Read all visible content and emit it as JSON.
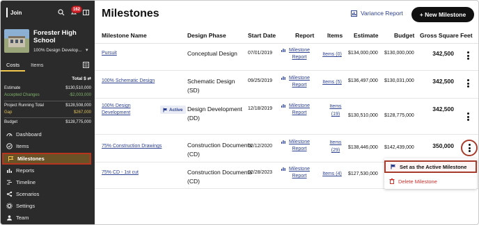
{
  "sidebar": {
    "logo": "Join",
    "notifications": "162",
    "project": {
      "name": "Forester High School",
      "phase": "100% Design Develop..."
    },
    "tabs": [
      "Costs",
      "Items"
    ],
    "total_label": "Total $",
    "costs": [
      {
        "label": "Estimate",
        "value": "$130,510,000",
        "tone": "white"
      },
      {
        "label": "Accepted Changes",
        "value": "-$2,003,000",
        "tone": "green"
      },
      {
        "label": "Project Running Total",
        "value": "$128,508,000",
        "tone": "white"
      },
      {
        "label": "Gap",
        "value": "$267,000",
        "tone": "yellow"
      },
      {
        "label": "Budget",
        "value": "$128,775,000",
        "tone": "white"
      }
    ],
    "nav": [
      "Dashboard",
      "Items",
      "Milestones",
      "Reports",
      "Timeline",
      "Scenarios",
      "Settings",
      "Team"
    ],
    "nav_active": "Milestones"
  },
  "header": {
    "title": "Milestones",
    "variance_label": "Variance Report",
    "new_label": "+ New Milestone"
  },
  "table": {
    "columns": [
      "Milestone Name",
      "Design Phase",
      "Start Date",
      "Report",
      "Items",
      "Estimate",
      "Budget",
      "Gross Square Feet"
    ],
    "rows": [
      {
        "name": "Pursuit",
        "phase": "Conceptual Design",
        "date": "07/01/2019",
        "report": "Milestone Report",
        "items": "Items (0)",
        "estimate": "$134,000,000",
        "budget": "$130,000,000",
        "gsf": "342,500"
      },
      {
        "name": "100% Schematic Design",
        "phase": "Schematic Design (SD)",
        "date": "09/25/2019",
        "report": "Milestone Report",
        "items": "Items (5)",
        "estimate": "$136,497,000",
        "budget": "$130,031,000",
        "gsf": "342,500"
      },
      {
        "name": "100% Design Development",
        "badge": "Active",
        "phase": "Design Development (DD)",
        "date": "12/18/2019",
        "report": "Milestone Report",
        "items": "Items (19)",
        "estimate": "$130,510,000",
        "budget": "$128,775,000",
        "gsf": "342,500"
      },
      {
        "name": "75% Construction Drawings",
        "phase": "Construction Documents (CD)",
        "date": "02/12/2020",
        "report": "Milestone Report",
        "items": "Items (29)",
        "estimate": "$138,446,000",
        "budget": "$142,439,000",
        "gsf": "350,000"
      },
      {
        "name": "75% CD - 1st cut",
        "phase": "Construction Documents (CD)",
        "date": "02/28/2023",
        "report": "Milestone Report",
        "items": "Items (4)",
        "estimate": "$127,530,000",
        "budget": "",
        "gsf": ""
      }
    ]
  },
  "menu": {
    "set_active": "Set as the Active Milestone",
    "delete": "Delete Milestone"
  },
  "colors": {
    "accent": "#2b3f8e",
    "sidebar": "#2b2b2b",
    "highlight": "#a63a2b",
    "danger": "#c9302c"
  }
}
